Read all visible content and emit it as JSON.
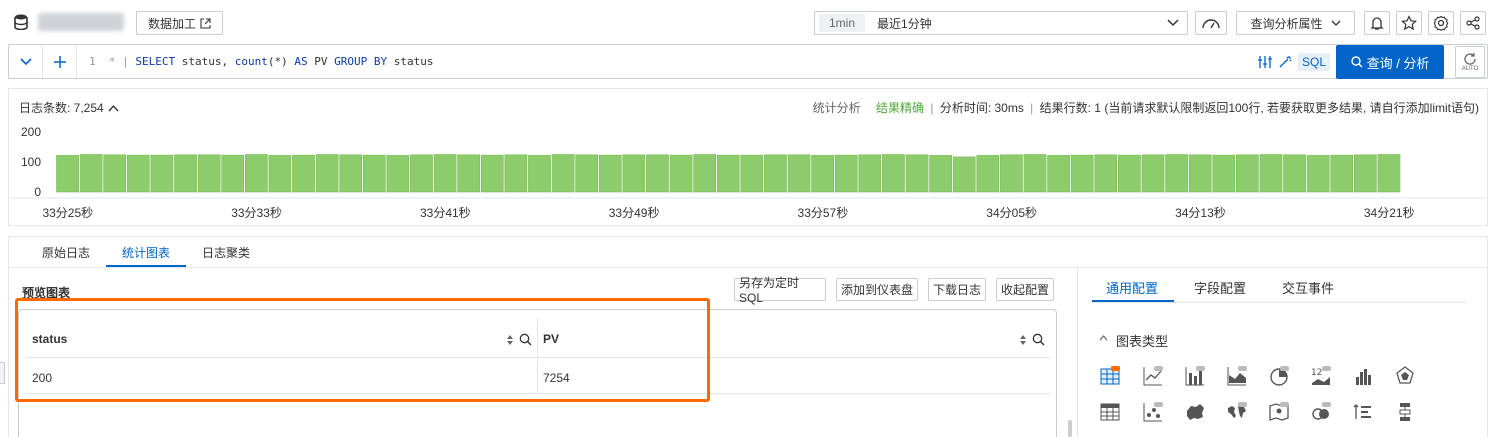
{
  "topbar": {
    "data_process_label": "数据加工",
    "time_tag": "1min",
    "time_range": "最近1分钟",
    "query_attr_label": "查询分析属性"
  },
  "query": {
    "line_number": "1",
    "star": "*",
    "pipe": "|",
    "sql_select": "SELECT",
    "sql_fields": "status, ",
    "sql_count": "count",
    "sql_count_arg": "(*) ",
    "sql_as": "AS",
    "sql_alias": " PV ",
    "sql_groupby": "GROUP BY",
    "sql_group_field": " status",
    "sql_toggle_label": "SQL",
    "search_button_label": "查询 / 分析",
    "auto_label": "AUTO"
  },
  "histogram": {
    "log_count_label": "日志条数: 7,254",
    "stats_label": "统计分析",
    "accurate_label": "结果精确",
    "analysis_time": "分析时间: 30ms",
    "result_rows": "结果行数: 1 (当前请求默认限制返回100行, 若要获取更多结果, 请自行添加limit语句)",
    "y_ticks": [
      "200",
      "100",
      "0"
    ],
    "x_ticks": [
      "33分25秒",
      "33分33秒",
      "33分41秒",
      "33分49秒",
      "33分57秒",
      "34分05秒",
      "34分13秒",
      "34分21秒"
    ]
  },
  "chart_data": {
    "type": "bar",
    "title": "",
    "xlabel": "",
    "ylabel": "",
    "ylim": [
      0,
      200
    ],
    "values": [
      122,
      125,
      124,
      123,
      123,
      124,
      124,
      123,
      125,
      122,
      123,
      125,
      124,
      123,
      122,
      124,
      125,
      124,
      123,
      124,
      122,
      125,
      124,
      123,
      124,
      124,
      123,
      125,
      123,
      123,
      124,
      124,
      122,
      123,
      124,
      125,
      124,
      122,
      117,
      122,
      124,
      125,
      122,
      123,
      124,
      123,
      124,
      125,
      124,
      123,
      124,
      125,
      124,
      122,
      123,
      124,
      125
    ],
    "color": "#8ccc6a"
  },
  "tabs": [
    "原始日志",
    "统计图表",
    "日志聚类"
  ],
  "preview": {
    "title": "预览图表",
    "btn_save_sql": "另存为定时SQL",
    "btn_add_dashboard": "添加到仪表盘",
    "btn_download": "下载日志",
    "btn_collapse": "收起配置"
  },
  "table": {
    "columns": [
      "status",
      "PV"
    ],
    "rows": [
      [
        "200",
        "7254"
      ]
    ]
  },
  "config": {
    "tabs": [
      "通用配置",
      "字段配置",
      "交互事件"
    ],
    "section_title": "图表类型"
  },
  "colors": {
    "accent": "#0064c8",
    "highlight": "#ff6a00",
    "green": "#52a836"
  }
}
